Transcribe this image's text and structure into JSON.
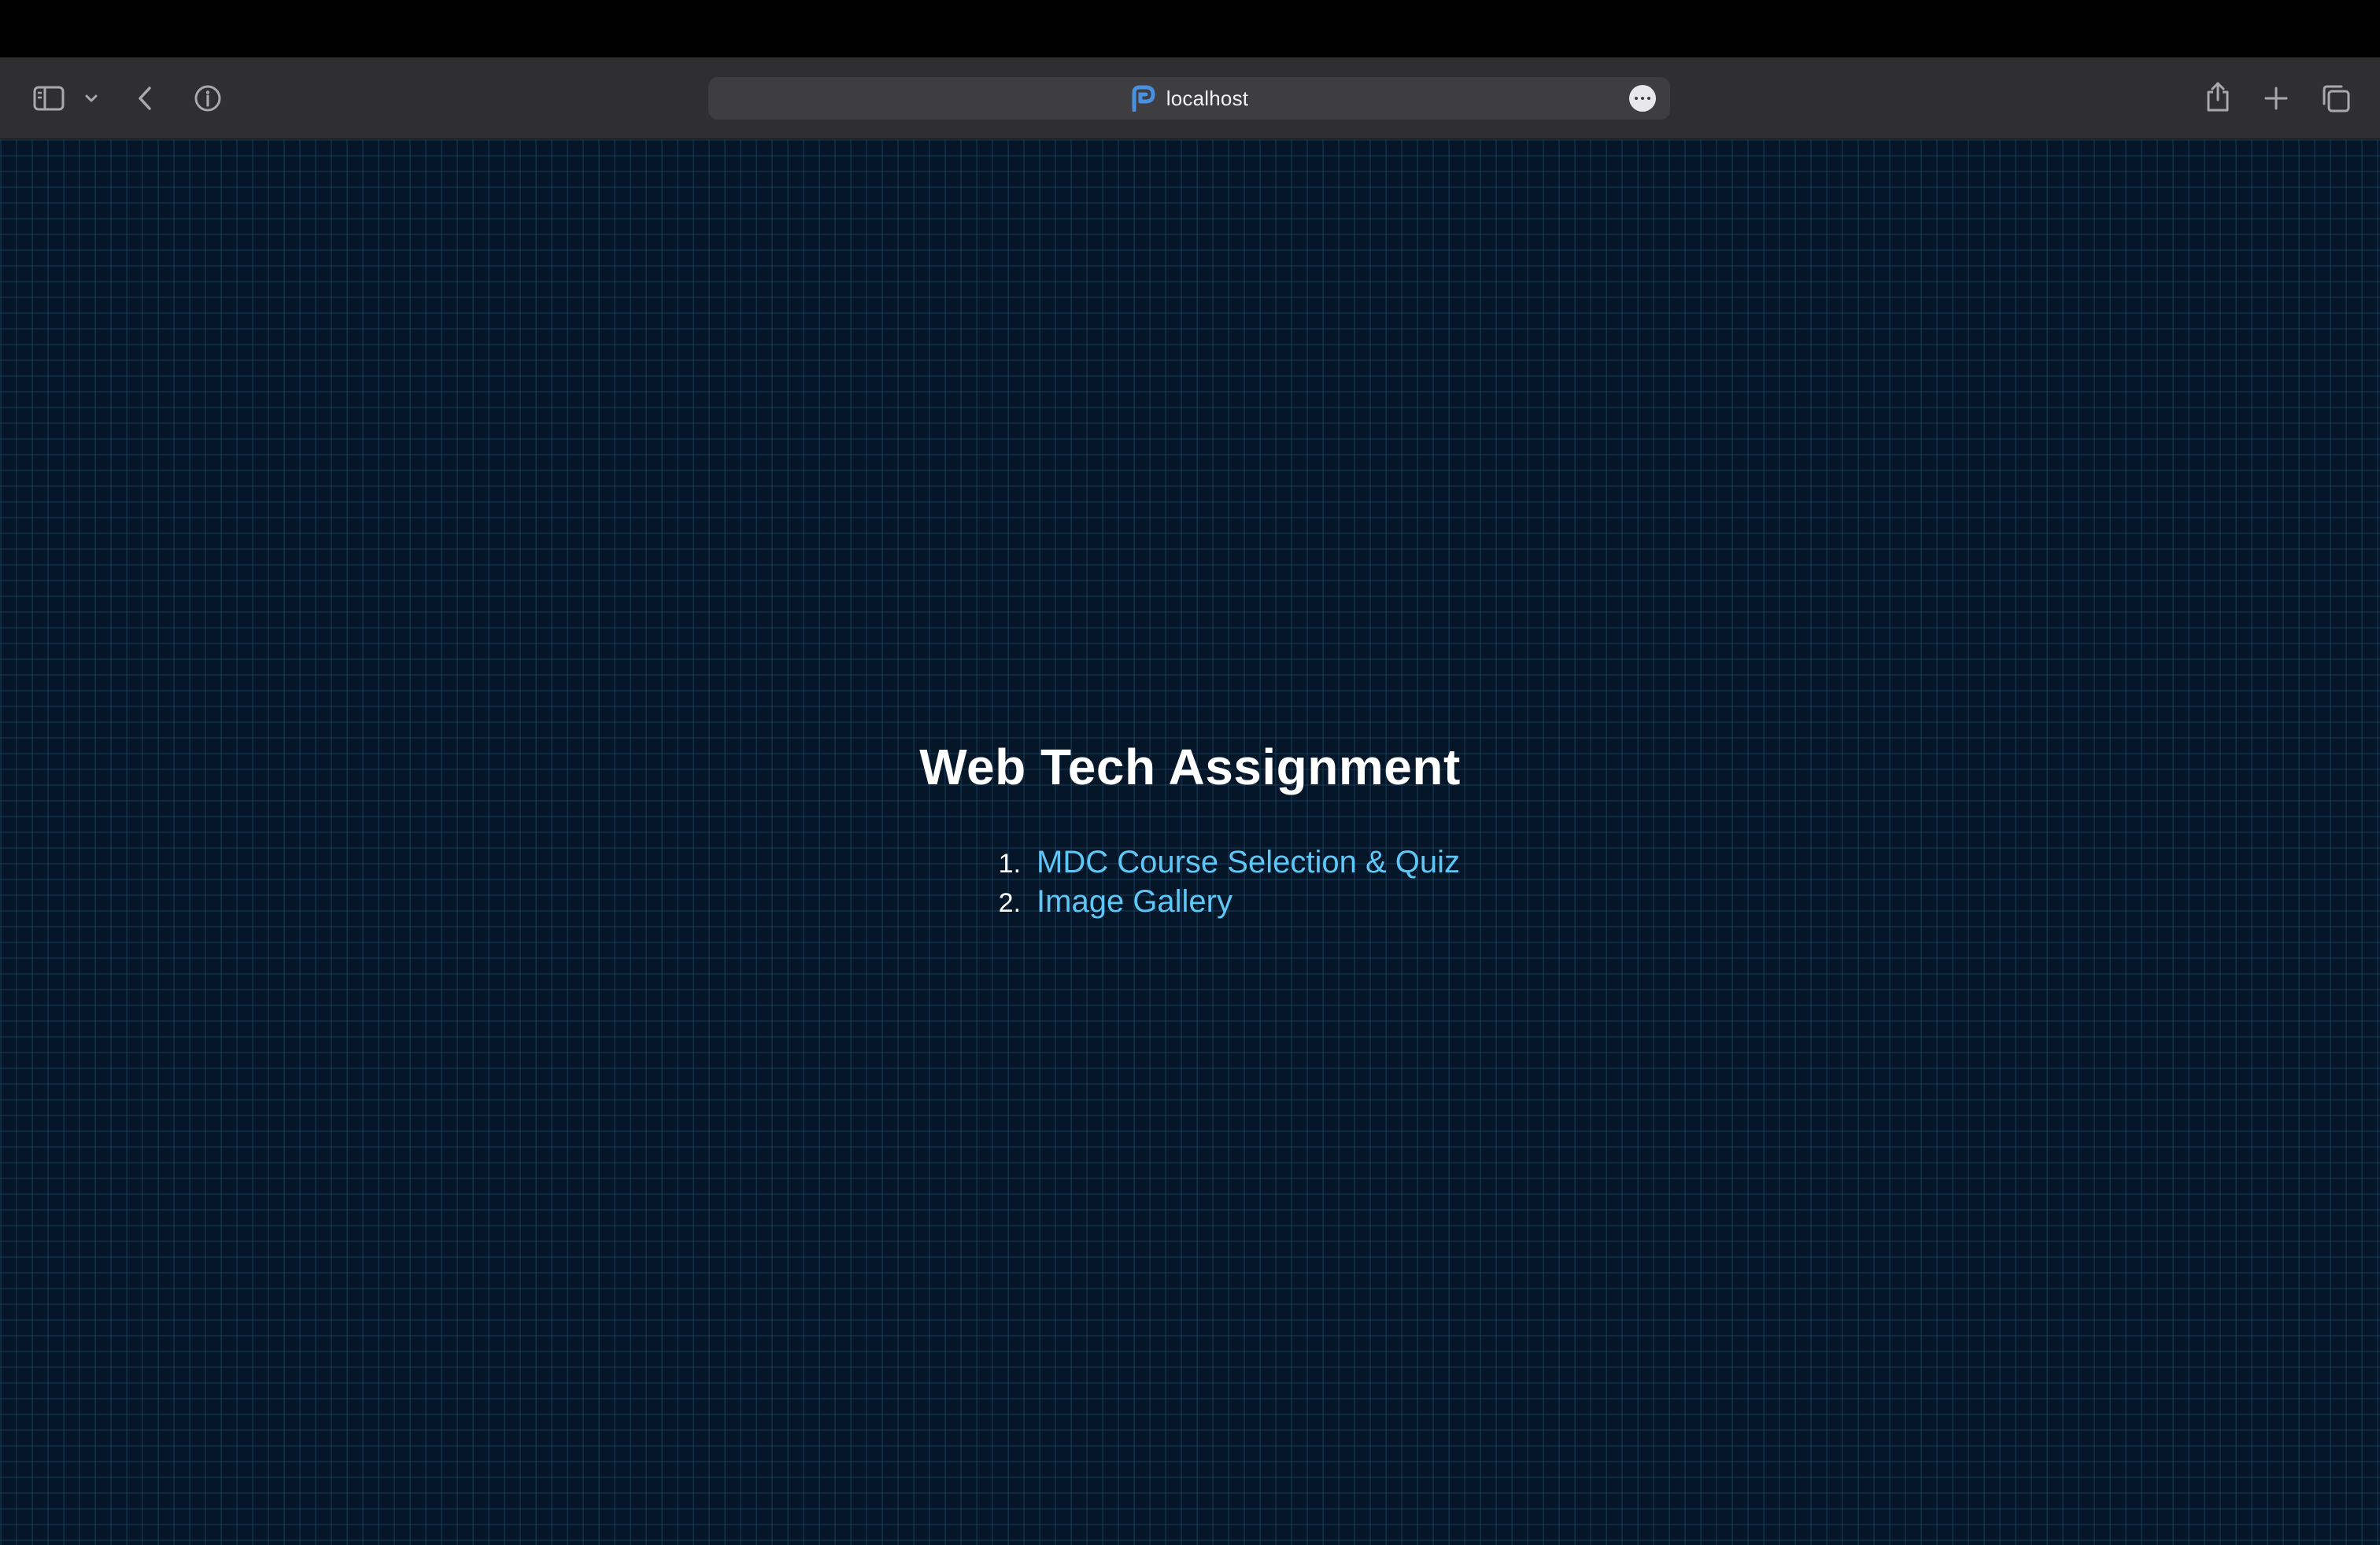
{
  "browser": {
    "url": "localhost",
    "icons": {
      "sidebar": "sidebar-icon",
      "sidebar_menu": "chevron-down-icon",
      "back": "chevron-left-icon",
      "info": "info-icon",
      "site": "site-favicon-icon",
      "page_menu": "more-icon",
      "share": "share-icon",
      "new_tab": "plus-icon",
      "tab_overview": "tabs-icon"
    }
  },
  "page": {
    "title": "Web Tech Assignment",
    "links": [
      {
        "number": "1.",
        "label": "MDC Course Selection & Quiz"
      },
      {
        "number": "2.",
        "label": "Image Gallery"
      }
    ]
  },
  "colors": {
    "background": "#041627",
    "grid": "#2a5a82",
    "title": "#ffffff",
    "link": "#5fc7f7",
    "toolbar": "#2f2f31"
  }
}
